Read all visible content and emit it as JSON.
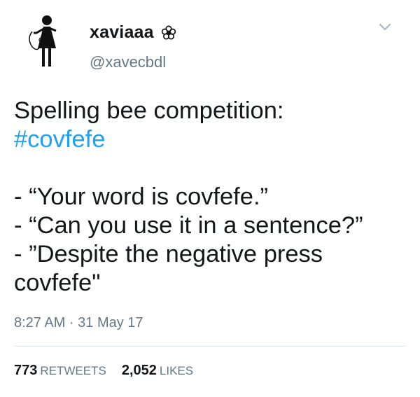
{
  "user": {
    "display_name": "xaviaaa",
    "handle": "@xavecbdl",
    "badge_icon": "flower-icon",
    "avatar_icon": "stick-figure-icon"
  },
  "tweet": {
    "line1": "Spelling bee competition:",
    "hashtag": "#covfefe",
    "line3": "- “Your word is covfefe.”",
    "line4": "- “Can you use it in a sentence?”",
    "line5": "- ”Despite the negative press",
    "line6": "covfefe\""
  },
  "meta": {
    "timestamp": "8:27 AM · 31 May 17"
  },
  "stats": {
    "retweets_count": "773",
    "retweets_label": "RETWEETS",
    "likes_count": "2,052",
    "likes_label": "LIKES"
  },
  "colors": {
    "link": "#1da1f2",
    "secondary_text": "#657786",
    "primary_text": "#14171a"
  }
}
